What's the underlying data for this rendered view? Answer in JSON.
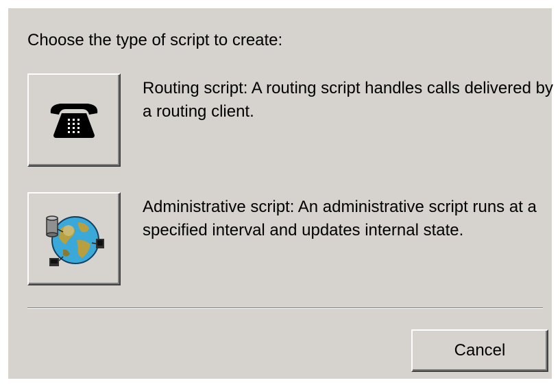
{
  "dialog": {
    "prompt": "Choose the type of script to create:",
    "options": [
      {
        "icon": "telephone-icon",
        "description": "Routing script: A routing script handles calls delivered by a routing client."
      },
      {
        "icon": "globe-network-icon",
        "description": "Administrative script: An administrative script runs at a specified interval and updates internal state."
      }
    ],
    "cancel_label": "Cancel"
  },
  "colors": {
    "dialog_background": "#d6d3ce",
    "globe_ocean": "#3aa8d8",
    "globe_land": "#b8a040"
  }
}
